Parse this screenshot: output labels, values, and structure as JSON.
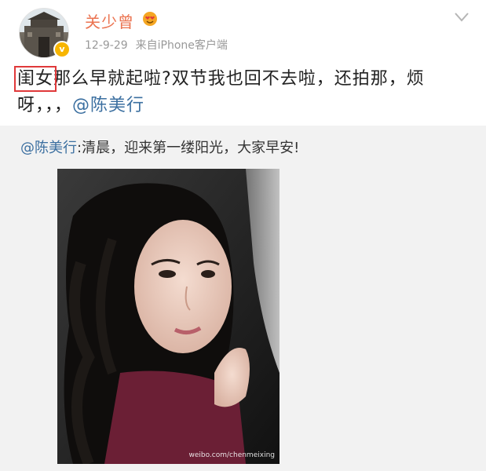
{
  "post": {
    "username": "关少曾",
    "date": "12-9-29",
    "source": "来自iPhone客户端",
    "text_highlight": "闺女",
    "text_body": "那么早就起啦?双节我也回不去啦，还拍那，烦呀，，，",
    "text_mention": "@陈美行"
  },
  "repost": {
    "mention": "@陈美行",
    "text": ":清晨，迎来第一缕阳光，大家早安!",
    "watermark": "weibo.com/chenmeixing"
  },
  "icons": {
    "avatar": "avatar-image",
    "verified": "verified-badge-icon",
    "vip": "vip-heart-eyes-icon",
    "menu": "chevron-down-icon"
  },
  "colors": {
    "username": "#eb7350",
    "mention": "#3b6fa0",
    "highlight_box": "#e0393a",
    "repost_bg": "#f2f2f2"
  }
}
